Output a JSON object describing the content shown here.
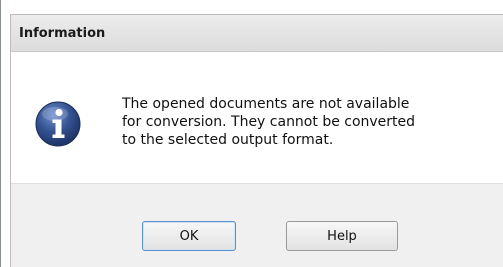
{
  "dialog": {
    "title": "Information",
    "icon": "info-icon",
    "message_lines": [
      "The opened documents are not available",
      "for conversion. They cannot be converted",
      "to the selected output format."
    ]
  },
  "buttons": {
    "ok_label": "OK",
    "help_label": "Help"
  },
  "colors": {
    "icon_blue": "#2f4f8f",
    "titlebar_bg": "#e4e4e4",
    "footer_bg": "#f0f0f0"
  }
}
